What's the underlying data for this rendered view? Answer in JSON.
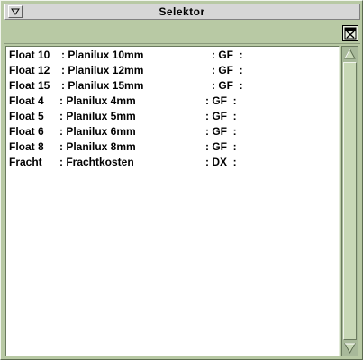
{
  "window": {
    "title": "Selektor"
  },
  "toolbar": {
    "button_icon": "close-box-icon"
  },
  "list": {
    "rows": [
      {
        "code": "Float 10",
        "desc": ": Planilux 10mm",
        "unit": ": GF  :"
      },
      {
        "code": "Float 12",
        "desc": ": Planilux 12mm",
        "unit": ": GF  :"
      },
      {
        "code": "Float 15",
        "desc": ": Planilux 15mm",
        "unit": ": GF  :"
      },
      {
        "code": "Float 4",
        "desc": ": Planilux 4mm",
        "unit": ": GF  :"
      },
      {
        "code": "Float 5",
        "desc": ": Planilux 5mm",
        "unit": ": GF  :"
      },
      {
        "code": "Float 6",
        "desc": ": Planilux 6mm",
        "unit": ": GF  :"
      },
      {
        "code": "Float 8",
        "desc": ": Planilux 8mm",
        "unit": ": GF  :"
      },
      {
        "code": "Fracht",
        "desc": ": Frachtkosten",
        "unit": ": DX  :"
      }
    ]
  },
  "colors": {
    "frame": "#b8c9a4",
    "titlebar": "#d6d6d6",
    "list_bg": "#ffffff",
    "scrollbar": "#a8b99a"
  }
}
